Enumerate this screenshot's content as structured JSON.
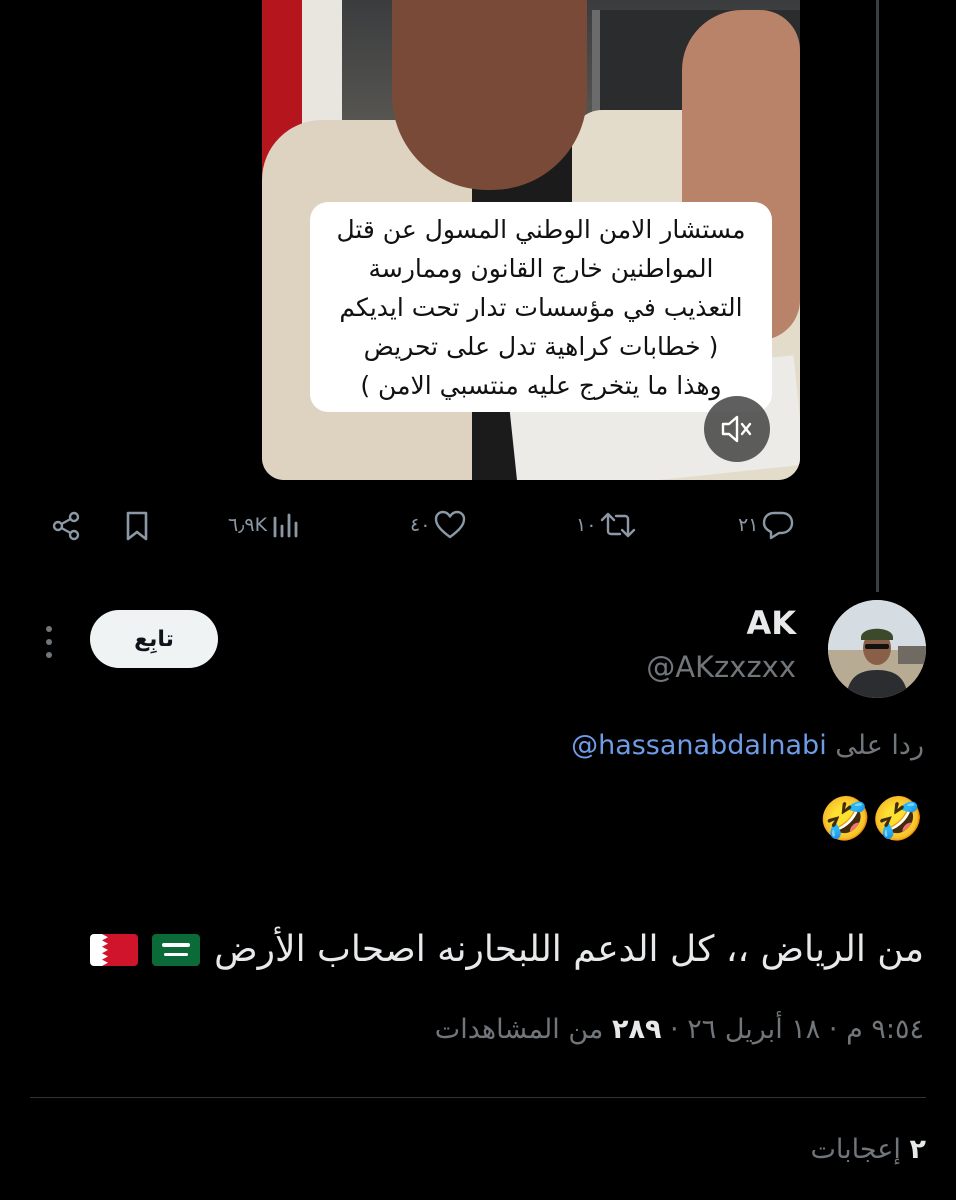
{
  "original_tweet": {
    "video_caption": "مستشار الامن الوطني المسول عن قتل\nالمواطنين خارج القانون وممارسة\nالتعذيب في مؤسسات تدار تحت ايديكم\n( خطابات كراهية تدل على تحريض\nوهذا ما يتخرج عليه منتسبي الامن )",
    "mute_icon": "speaker-muted-icon",
    "actions": {
      "replies": "٢١",
      "reposts": "١٠",
      "likes": "٤٠",
      "views": "٦٫٩K"
    }
  },
  "reply": {
    "display_name": "AK",
    "handle": "@AKzxzxx",
    "follow_label": "تابِع",
    "replying_to_prefix": "ردا على",
    "replying_to_handle": "@hassanabdalnabi",
    "emoji_line": "🤣🤣",
    "body_text": "من الرياض ،، كل الدعم اللبحارنه اصحاب الأرض",
    "flags": [
      "saudi-flag",
      "bahrain-flag"
    ],
    "meta": {
      "time": "٩:٥٤ م",
      "date": "١٨ أبريل ٢٦",
      "separator": "·",
      "views_count": "٢٨٩",
      "views_label": "من المشاهدات"
    },
    "likes": {
      "count": "٢",
      "label": "إعجابات"
    }
  },
  "colors": {
    "background": "#000000",
    "text": "#e7e9ea",
    "secondary": "#71767b",
    "link": "#6e9ce6",
    "follow_bg": "#eff3f4"
  }
}
